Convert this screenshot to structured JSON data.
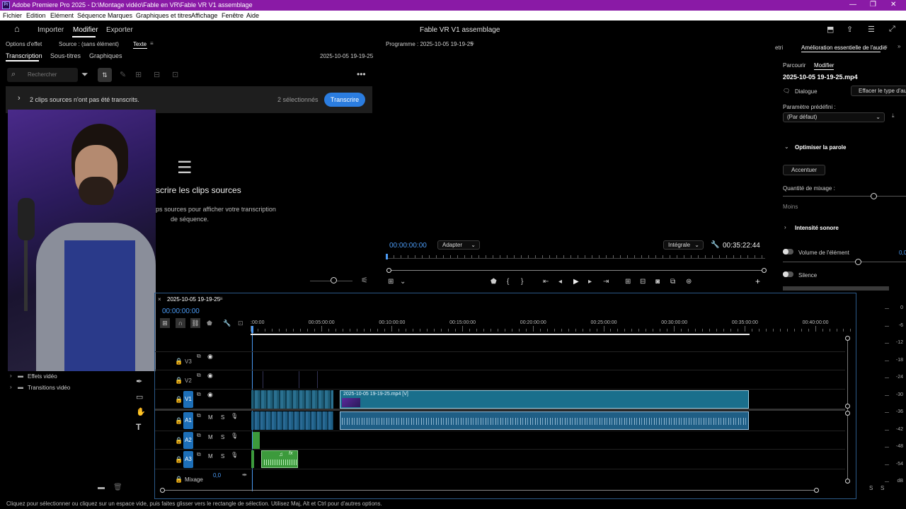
{
  "window": {
    "title": "Adobe Premiere Pro 2025 - D:\\Montage vidéo\\Fable en VR\\Fable VR V1 assemblage",
    "app_icon": "Pr"
  },
  "menu": [
    "Fichier",
    "Edition",
    "Elément",
    "Séquence",
    "Marques",
    "Graphiques et titres",
    "Affichage",
    "Fenêtre",
    "Aide"
  ],
  "topnav": {
    "import": "Importer",
    "edit": "Modifier",
    "export": "Exporter",
    "project": "Fable VR V1 assemblage"
  },
  "left_panel": {
    "tabs_top": {
      "effect_options": "Options d'effet",
      "source": "Source : (sans élément)",
      "text": "Texte"
    },
    "tabs": [
      "Transcription",
      "Sous-titres",
      "Graphiques"
    ],
    "date": "2025-10-05 19-19-25",
    "search_placeholder": "Rechercher",
    "notice": "2 clips sources n'ont pas été transcrits.",
    "selected": "2 sélectionnés",
    "transcribe_btn": "Transcrire",
    "heading": "scrire les clips sources",
    "body_line1": "ps sources pour afficher votre transcription",
    "body_line2": "de séquence."
  },
  "project_tree": [
    "Effets vidéo",
    "Transitions vidéo"
  ],
  "program": {
    "title": "Programme : 2025-10-05 19-19-25",
    "timecode": "00:00:00:00",
    "fit": "Adapter",
    "quality": "Intégrale",
    "duration": "00:35:22:44"
  },
  "essential_sound": {
    "tab_prev": "etri",
    "title": "Amélioration essentielle de l'audio",
    "tabs": [
      "Parcourir",
      "Modifier"
    ],
    "clip": "2025-10-05 19-19-25.mp4",
    "type": "Dialogue",
    "clear_type": "Effacer le type d'audio",
    "preset_label": "Paramètre prédéfini :",
    "preset_value": "(Par défaut)",
    "optimize": "Optimiser la parole",
    "emphasize": "Accentuer",
    "mix_amount": "Quantité de mixage :",
    "less": "Moins",
    "loudness": "Intensité sonore",
    "clip_volume": "Volume de l'élément",
    "clip_volume_val": "0,0",
    "mute": "Silence"
  },
  "timeline": {
    "sequence": "2025-10-05 19-19-25",
    "timecode": "00:00:00:00",
    "ruler": [
      ":00:00",
      "00:05:00:00",
      "00:10:00:00",
      "00:15:00:00",
      "00:20:00:00",
      "00:25:00:00",
      "00:30:00:00",
      "00:35:00:00",
      "00:40:00:00"
    ],
    "video_tracks": [
      "V3",
      "V2",
      "V1"
    ],
    "audio_tracks": [
      "A1",
      "A2",
      "A3"
    ],
    "track_m": "M",
    "track_s": "S",
    "mix_label": "Mixage",
    "mix_value": "0,0",
    "clip_v1": "2025-10-05 19-19-25.mp4 [V]"
  },
  "meter": {
    "ticks": [
      "0",
      "-6",
      "-12",
      "-18",
      "-24",
      "-30",
      "-36",
      "-42",
      "-48",
      "-54",
      "dB"
    ],
    "solo": "S"
  },
  "status_bar": "Cliquez pour sélectionner ou cliquez sur un espace vide, puis faites glisser vers le rectangle de sélection. Utilisez Maj, Alt et Ctrl pour d'autres options.",
  "colors": {
    "title_bar": "#8a1aa6",
    "accent_blue": "#2b7de0",
    "clip_video": "#1a6f8c",
    "clip_audio": "#1f5e85",
    "clip_green": "#3c9a3c"
  }
}
